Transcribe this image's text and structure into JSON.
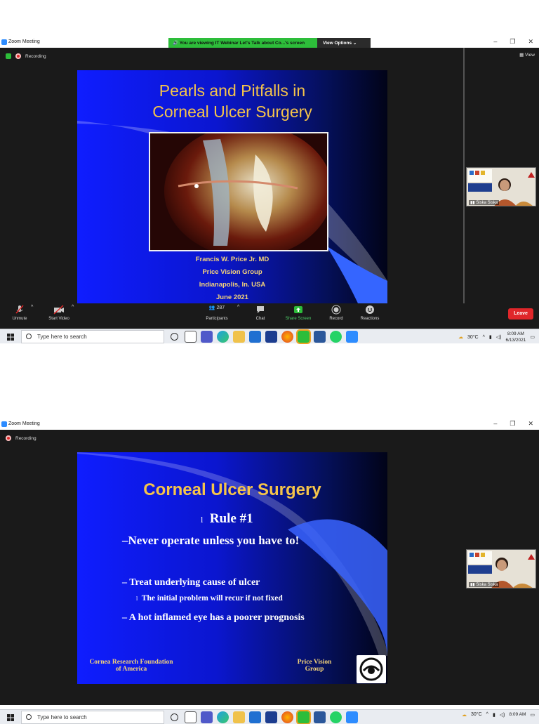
{
  "screens": [
    {
      "window_title": "Zoom Meeting",
      "share_banner": "You are viewing IT Webinar Let's Talk about Co...'s screen",
      "view_options": "View Options ⌄",
      "view_label": "View",
      "recording_label": "Recording",
      "slide": {
        "title_line1": "Pearls and Pitfalls in",
        "title_line2": "Corneal Ulcer Surgery",
        "author": "Francis W. Price Jr. MD",
        "org": "Price Vision Group",
        "location": "Indianapolis, In.  USA",
        "date": "June 2021"
      },
      "participant_name": "Siska Siska",
      "toolbar": {
        "unmute": "Unmute",
        "start_video": "Start Video",
        "participants_count": "287",
        "participants": "Participants",
        "chat": "Chat",
        "share_screen": "Share Screen",
        "record": "Record",
        "reactions": "Reactions",
        "leave": "Leave"
      },
      "taskbar": {
        "search_placeholder": "Type here to search",
        "temperature": "30°C",
        "time": "8:09 AM",
        "date": "6/13/2021"
      }
    },
    {
      "window_title": "Zoom Meeting",
      "recording_label": "Recording",
      "slide": {
        "title": "Corneal Ulcer Surgery",
        "rule": "Rule #1",
        "never": "–Never operate unless you have to!",
        "treat": "– Treat underlying cause of ulcer",
        "initial": "The initial problem will recur if not fixed",
        "hot": "– A hot inflamed eye has a poorer prognosis",
        "foundation_line1": "Cornea Research Foundation",
        "foundation_line2": "of America",
        "pvg_line1": "Price Vision",
        "pvg_line2": "Group"
      },
      "participant_name": "Siska Siska",
      "taskbar": {
        "search_placeholder": "Type here to search",
        "temperature": "30°C",
        "time": "8:09 AM"
      }
    }
  ],
  "colors": {
    "slide_title": "#f5c44a",
    "share_green": "#2dbd3a",
    "leave_red": "#e0262a",
    "meeting_bg": "#1a1a1a"
  }
}
